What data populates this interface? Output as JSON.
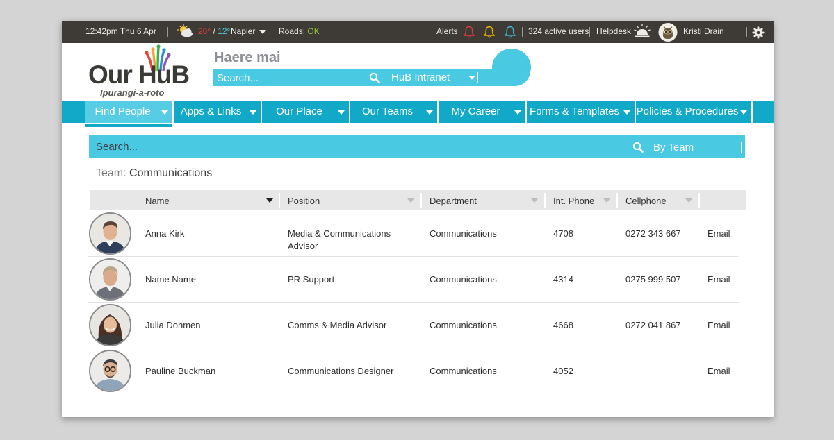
{
  "topbar": {
    "datetime": "12:42pm Thu 6 Apr",
    "weather": {
      "high": "20°",
      "slash": " / ",
      "low": "12°",
      "location": "Napier"
    },
    "roads": {
      "label": "Roads:",
      "status": "OK"
    },
    "alerts_label": "Alerts",
    "alert_icons": [
      {
        "name": "bell-icon",
        "color": "#e13a3a"
      },
      {
        "name": "bell-icon",
        "color": "#f2b500"
      },
      {
        "name": "bell-icon",
        "color": "#3fb6d6"
      }
    ],
    "active_users": "324 active users",
    "helpdesk": "Helpdesk",
    "user_name": "Kristi Drain"
  },
  "header": {
    "logo_title": "Our HuB",
    "logo_subtitle": "Ipurangi-a-roto",
    "greeting": "Haere mai",
    "search_placeholder": "Search...",
    "scope_select": "HuB Intranet"
  },
  "nav": {
    "items": [
      {
        "label": "Find People"
      },
      {
        "label": "Apps & Links"
      },
      {
        "label": "Our Place"
      },
      {
        "label": "Our Teams"
      },
      {
        "label": "My Career"
      },
      {
        "label": "Forms & Templates"
      },
      {
        "label": "Policies & Procedures"
      }
    ]
  },
  "people_search": {
    "placeholder": "Search...",
    "filter": "By Team"
  },
  "team": {
    "label": "Team:",
    "name": "Communications"
  },
  "table": {
    "columns": [
      "Name",
      "Position",
      "Department",
      "Int. Phone",
      "Cellphone"
    ],
    "rows": [
      {
        "name": "Anna Kirk",
        "position": "Media & Communications Advisor",
        "department": "Communications",
        "phone": "4708",
        "cell": "0272 343 667",
        "email": "Email"
      },
      {
        "name": "Name Name",
        "position": "PR Support",
        "department": "Communications",
        "phone": "4314",
        "cell": "0275 999 507",
        "email": "Email"
      },
      {
        "name": "Julia Dohmen",
        "position": "Comms & Media Advisor",
        "department": "Communications",
        "phone": "4668",
        "cell": "0272 041 867",
        "email": "Email"
      },
      {
        "name": "Pauline Buckman",
        "position": "Communications Designer",
        "department": "Communications",
        "phone": "4052",
        "cell": "",
        "email": "Email"
      }
    ]
  },
  "colors": {
    "accent_cyan": "#4ac9e2",
    "nav_teal": "#12a9c9",
    "topbar_dark": "#3e3b36"
  }
}
